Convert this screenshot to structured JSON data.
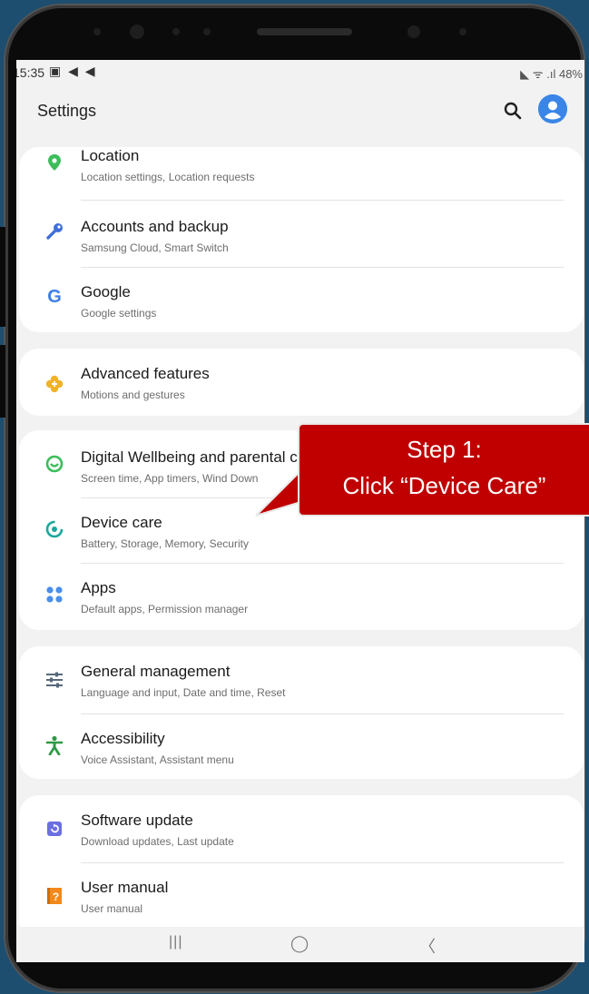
{
  "status_bar": {
    "time": "15:35",
    "left_icons": "▣ ◀ ◀",
    "right": "◣ ᯤ .ıl 48%"
  },
  "header": {
    "title": "Settings",
    "search_icon": "search-icon",
    "profile_icon": "account-icon"
  },
  "cards": [
    {
      "items": [
        {
          "title": "Location",
          "subtitle": "Location settings, Location requests",
          "icon": "location-pin-icon",
          "color": "#3dbd5a"
        },
        {
          "title": "Accounts and backup",
          "subtitle": "Samsung Cloud, Smart Switch",
          "icon": "key-icon",
          "color": "#3f6fd9"
        },
        {
          "title": "Google",
          "subtitle": "Google settings",
          "icon": "google-icon",
          "color": "#3f7ee8"
        }
      ]
    },
    {
      "items": [
        {
          "title": "Advanced features",
          "subtitle": "Motions and gestures",
          "icon": "advanced-features-icon",
          "color": "#f0b22a"
        }
      ]
    },
    {
      "items": [
        {
          "title": "Digital Wellbeing and parental controls",
          "subtitle": "Screen time, App timers, Wind Down",
          "icon": "wellbeing-icon",
          "color": "#3dbd5a"
        },
        {
          "title": "Device care",
          "subtitle": "Battery, Storage, Memory, Security",
          "icon": "device-care-icon",
          "color": "#1aa89a"
        },
        {
          "title": "Apps",
          "subtitle": "Default apps, Permission manager",
          "icon": "apps-icon",
          "color": "#4b8ee8"
        }
      ]
    },
    {
      "items": [
        {
          "title": "General management",
          "subtitle": "Language and input, Date and time, Reset",
          "icon": "sliders-icon",
          "color": "#56687a"
        },
        {
          "title": "Accessibility",
          "subtitle": "Voice Assistant, Assistant menu",
          "icon": "accessibility-icon",
          "color": "#2f9a45"
        }
      ]
    },
    {
      "items": [
        {
          "title": "Software update",
          "subtitle": "Download updates, Last update",
          "icon": "software-update-icon",
          "color": "#6b6fe0"
        },
        {
          "title": "User manual",
          "subtitle": "User manual",
          "icon": "user-manual-icon",
          "color": "#f08a1c"
        }
      ]
    }
  ],
  "callout": {
    "line1": "Step 1:",
    "line2": "Click “Device Care”",
    "color": "#c00000"
  },
  "navbar": {
    "recents": "|||",
    "home": "◯",
    "back": "〈"
  }
}
